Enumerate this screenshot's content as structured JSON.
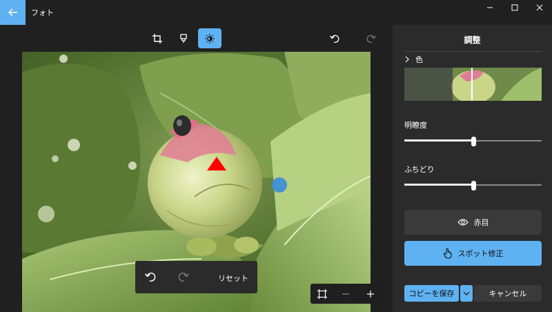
{
  "app": {
    "title": "フォト"
  },
  "toolbar": {
    "tools": [
      {
        "name": "crop",
        "icon": "crop-icon",
        "active": false
      },
      {
        "name": "markup",
        "icon": "brush-icon",
        "active": false
      },
      {
        "name": "adjust",
        "icon": "brightness-icon",
        "active": true
      }
    ],
    "undo_icon": "undo-icon",
    "redo_icon": "redo-icon"
  },
  "float_bar": {
    "reset_label": "リセット"
  },
  "panel": {
    "title": "調整",
    "color_section": "色",
    "clarity_label": "明瞭度",
    "clarity_value": 0.5,
    "vignette_label": "ふちどり",
    "vignette_value": 0.5,
    "red_eye_label": "赤目",
    "spot_fix_label": "スポット修正",
    "save_copy_label": "コピーを保存",
    "cancel_label": "キャンセル"
  },
  "colors": {
    "accent": "#5fb2f2",
    "background": "#202020",
    "panel": "#2b2b2b",
    "marker_red": "#ff0000",
    "marker_blue": "#3d8fd6"
  }
}
